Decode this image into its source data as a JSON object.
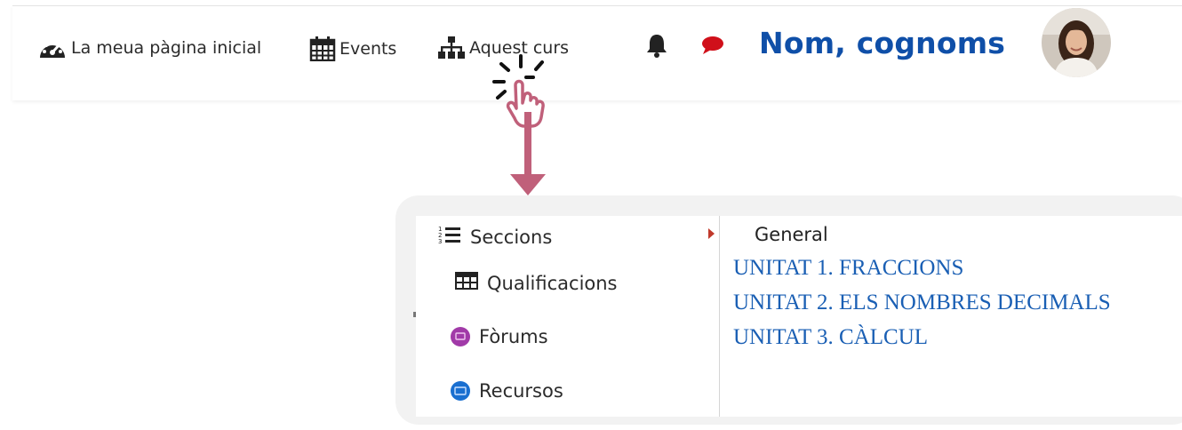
{
  "navbar": {
    "home_label": "La meua pàgina inicial",
    "events_label": "Events",
    "course_label": "Aquest curs",
    "user_name": "Nom, cognoms",
    "icons": [
      "dashboard-icon",
      "calendar-icon",
      "sitemap-icon",
      "bell-icon",
      "chat-icon"
    ]
  },
  "course_menu": {
    "items": [
      {
        "label": "Seccions",
        "icon": "list-icon"
      },
      {
        "label": "Qualificacions",
        "icon": "table-icon"
      },
      {
        "label": "Fòrums",
        "icon": "forum-icon"
      },
      {
        "label": "Recursos",
        "icon": "resources-icon"
      }
    ],
    "submenu": {
      "general": "General",
      "units": [
        "UNITAT 1. FRACCIONS",
        "UNITAT 2. ELS NOMBRES DECIMALS",
        "UNITAT 3. CÀLCUL"
      ]
    }
  },
  "colors": {
    "link_blue": "#1a5fb4",
    "user_blue": "#0f4fa8",
    "arrow": "#c0607a",
    "chat_red": "#d0101a",
    "forum_purple": "#a13aa8",
    "resources_blue": "#1a6fd0"
  }
}
